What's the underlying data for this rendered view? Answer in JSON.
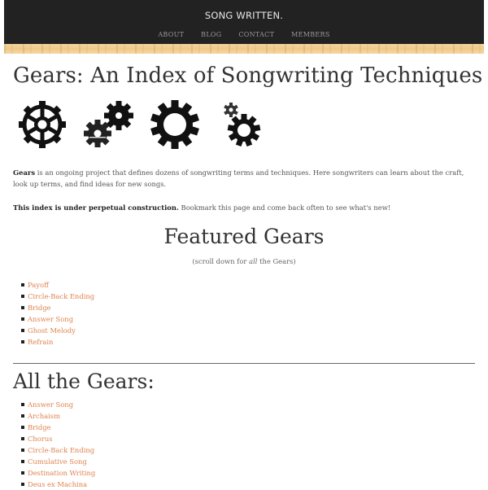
{
  "header": {
    "site_title": "SONG WRITTEN.",
    "nav": [
      {
        "label": "ABOUT"
      },
      {
        "label": "BLOG"
      },
      {
        "label": "CONTACT"
      },
      {
        "label": "MEMBERS"
      }
    ]
  },
  "main": {
    "title": "Gears: An Index of Songwriting Techniques",
    "gear_images": [
      {
        "icon": "gear-spoked-icon"
      },
      {
        "icon": "two-gears-icon"
      },
      {
        "icon": "gear-ring-icon"
      },
      {
        "icon": "small-and-large-gear-icon"
      }
    ],
    "intro": {
      "bold": "Gears",
      "text": " is an ongoing project that defines dozens of songwriting terms and techniques. Here songwriters can learn about the craft, look up terms, and find ideas for new songs."
    },
    "notice": {
      "bold": "This index is under perpetual construction.",
      "text": " Bookmark this page and come back often to see what's new!"
    },
    "featured": {
      "title": "Featured Gears",
      "note_before": "(scroll down for ",
      "note_em": "all",
      "note_after": " the Gears)",
      "items": [
        {
          "label": "Payoff"
        },
        {
          "label": "Circle-Back Ending"
        },
        {
          "label": "Bridge"
        },
        {
          "label": "Answer Song"
        },
        {
          "label": "Ghost Melody"
        },
        {
          "label": "Refrain"
        }
      ]
    },
    "all": {
      "title": "All the Gears:",
      "items": [
        {
          "label": "Answer Song"
        },
        {
          "label": "Archaism"
        },
        {
          "label": "Bridge"
        },
        {
          "label": "Chorus"
        },
        {
          "label": "Circle-Back Ending"
        },
        {
          "label": "Cumulative Song"
        },
        {
          "label": "Destination Writing"
        },
        {
          "label": "Deus ex Machina"
        }
      ]
    }
  },
  "colors": {
    "header_bg": "#222222",
    "link": "#e0834e",
    "wood": "#efc98b"
  }
}
